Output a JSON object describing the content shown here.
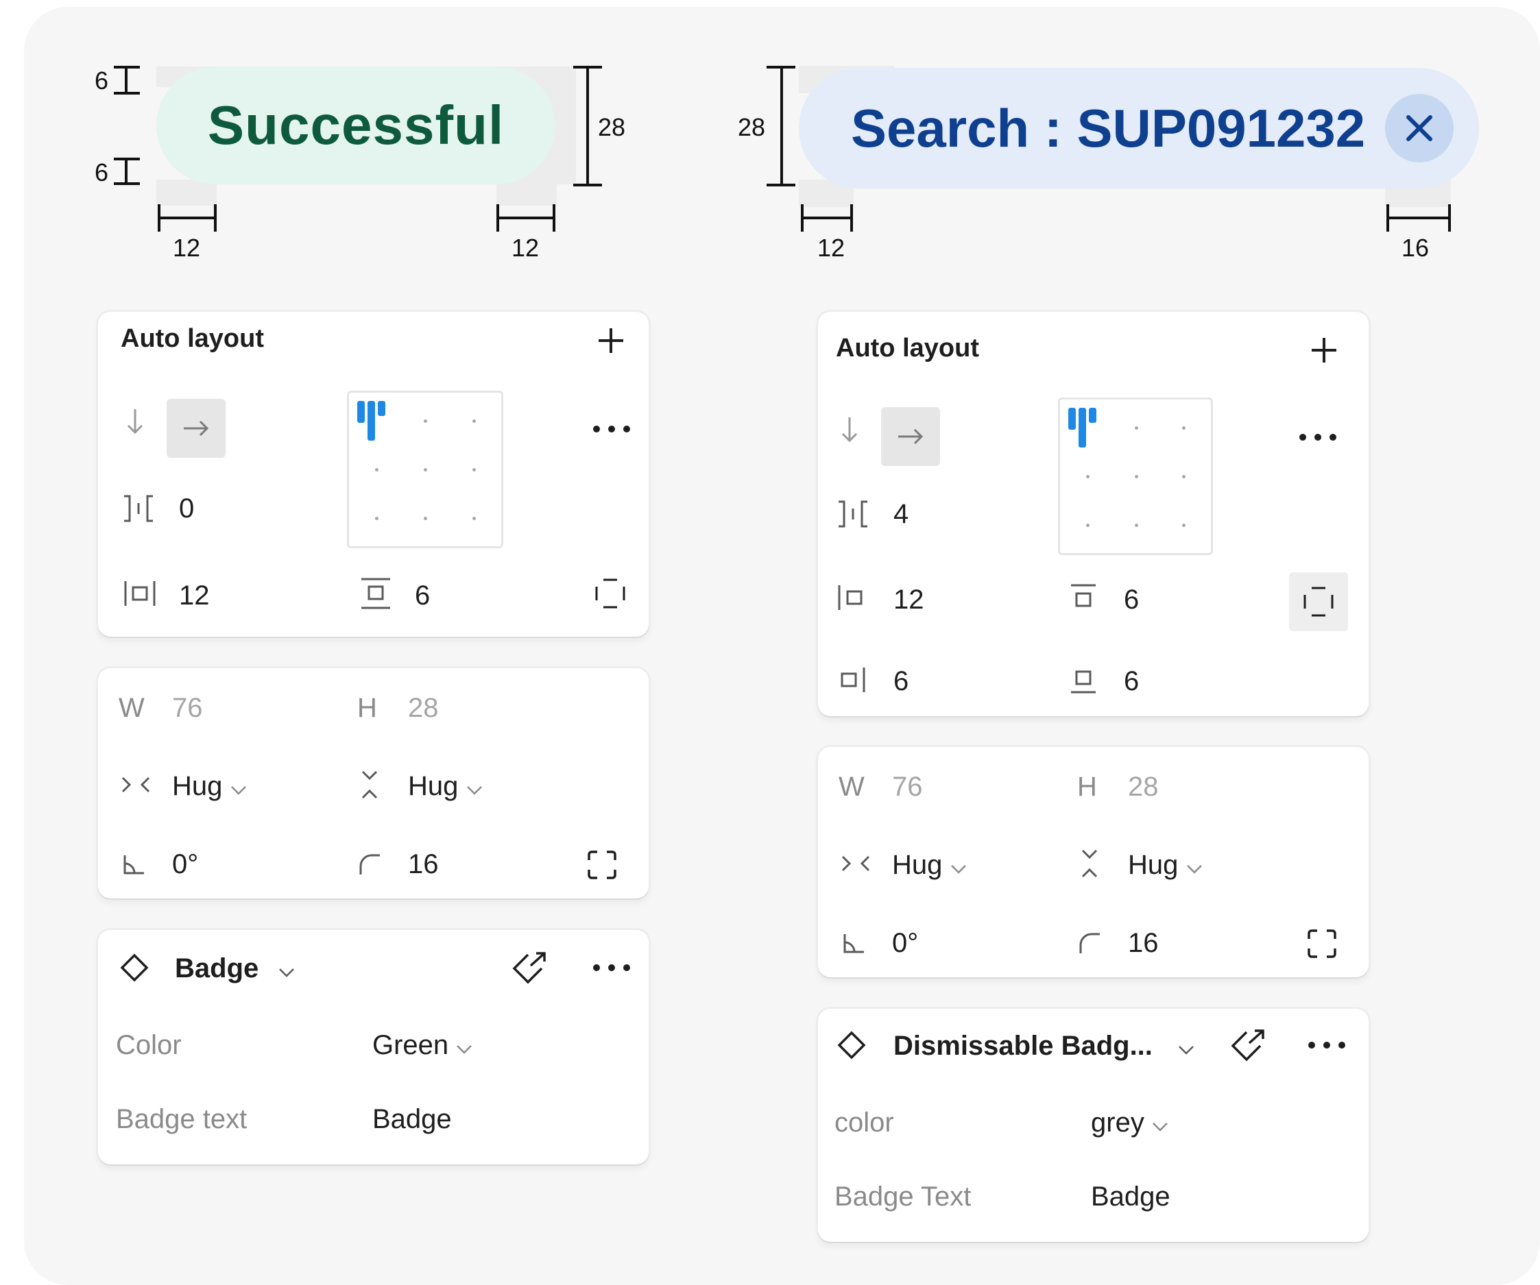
{
  "badges": {
    "success": {
      "text": "Successful",
      "bg": "#e4f4ee",
      "fg": "#0e5a3e"
    },
    "search": {
      "text": "Search : SUP091232",
      "bg": "#e3ecf8",
      "fg": "#0f3f8f",
      "close_icon": "close-icon"
    }
  },
  "dimensions": {
    "left_top_padding": "6",
    "left_bottom_padding": "6",
    "left_height": "28",
    "left_pad_left": "12",
    "left_pad_right": "12",
    "right_height": "28",
    "right_pad_left": "12",
    "right_pad_right": "16"
  },
  "left": {
    "auto_layout": {
      "title": "Auto layout",
      "gap": "0",
      "pad_h": "12",
      "pad_v": "6",
      "icons": [
        "add-icon",
        "arrow-down-icon",
        "arrow-right-icon",
        "gap-icon",
        "horizontal-padding-icon",
        "vertical-padding-icon",
        "individual-padding-icon",
        "more-icon"
      ]
    },
    "size": {
      "w_label": "W",
      "w_value": "76",
      "h_label": "H",
      "h_value": "28",
      "hug_w": "Hug",
      "hug_h": "Hug",
      "rotation": "0°",
      "radius": "16"
    },
    "component": {
      "name": "Badge",
      "prop1_label": "Color",
      "prop1_value": "Green",
      "prop2_label": "Badge text",
      "prop2_value": "Badge"
    }
  },
  "right": {
    "auto_layout": {
      "title": "Auto layout",
      "gap": "4",
      "pad_left": "12",
      "pad_top": "6",
      "pad_right": "6",
      "pad_bottom": "6"
    },
    "size": {
      "w_label": "W",
      "w_value": "76",
      "h_label": "H",
      "h_value": "28",
      "hug_w": "Hug",
      "hug_h": "Hug",
      "rotation": "0°",
      "radius": "16"
    },
    "component": {
      "name": "Dismissable Badg...",
      "prop1_label": "color",
      "prop1_value": "grey",
      "prop2_label": "Badge Text",
      "prop2_value": "Badge"
    }
  },
  "colors": {
    "accent": "#1e88e5",
    "panel": "#ffffff",
    "canvas": "#f6f6f6"
  }
}
